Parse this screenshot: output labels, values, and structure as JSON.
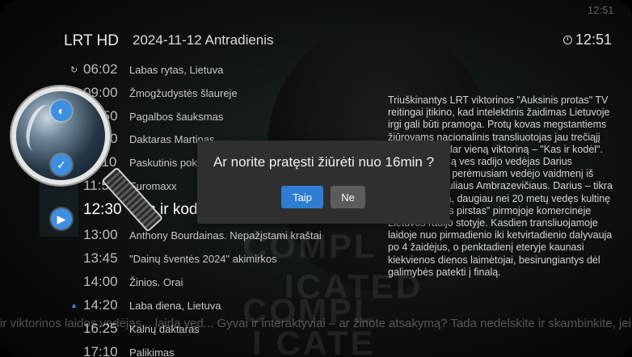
{
  "header": {
    "channel": "LRT HD",
    "date": "2024-11-12 Antradienis",
    "time": "12:51",
    "top_right": "12:51"
  },
  "schedule": [
    {
      "time": "06:02",
      "title": "Labas rytas, Lietuva",
      "icon": "replay-icon"
    },
    {
      "time": "09:00",
      "title": "Žmogžudystės šlaureje",
      "icon": ""
    },
    {
      "time": "09:50",
      "title": "Pagalbos šauksmas",
      "icon": ""
    },
    {
      "time": "10:20",
      "title": "Daktaras Martinas",
      "icon": ""
    },
    {
      "time": "11:10",
      "title": "Paskutinis pokalbis",
      "icon": ""
    },
    {
      "time": "11:55",
      "title": "Euromaxx",
      "icon": ""
    },
    {
      "time": "12:30",
      "title": "Kas ir kodėl",
      "icon": "",
      "current": true
    },
    {
      "time": "13:00",
      "title": "Anthony Bourdainas. Nepažįstami kraštai",
      "icon": ""
    },
    {
      "time": "13:45",
      "title": "\"Dainų šventės 2024\" akimirkos",
      "icon": ""
    },
    {
      "time": "14:00",
      "title": "Žinios. Orai",
      "icon": ""
    },
    {
      "time": "14:20",
      "title": "Laba diena, Lietuva",
      "icon": "reminder-icon"
    },
    {
      "time": "16:25",
      "title": "Kalnų daktaras",
      "icon": ""
    },
    {
      "time": "17:10",
      "title": "Palikimas",
      "icon": ""
    }
  ],
  "description": "Triuškinantys LRT viktorinos \"Auksinis protas\" TV reitingai įtikino, kad intelektinis žaidimas Lietuvoje irgi gali būti pramoga. Protų kovas megstantiems žiūrovams nacionalinis transliuotojas jau trečiąjį sezoną siūlo dar vieną viktoriną – \"Kas ir kodėl\". Šį sezoną laidą ves radijo vedėjas Darius Jurgelevičius, perėmusiam vedėjo vaidmenį iš humoristo Pauliaus Ambrazevičiaus. Darius – tikra radijo legenda, daugiau nei 20 metų vedęs kultinę laidą \"Mikliusis pirstas\" pirmojoje komercinėje Lietuvos radijo stotyje. Kasdien transliuojamoje laidoje nuo pirmadienio iki ketvirtadienio dalyvauja po 4 žaidėjus, o penktadienį eteryje kaunasi kiekvienos dienos laimėtojai, besirungiantys dėl galimybės patekti į finalą.",
  "ticker": "ir viktorinos laidos vedėjas... laidą ved... Gyvai ir interaktyviai – ar žinote atsakymą? Tada nedelskite ir skambinkite, jei esate pasiruošę žaisti...",
  "background_text": [
    "COMPL",
    "ICATED",
    "COMPL",
    "I CATE"
  ],
  "dialog": {
    "message": "Ar norite pratęsti žiūrėti nuo 16min ?",
    "yes_label": "Taip",
    "no_label": "Ne"
  },
  "overlay": {
    "lens_icon": "magnifier-icon",
    "buttons": [
      "contrast-icon",
      "check-icon",
      "play-icon"
    ]
  },
  "colors": {
    "accent": "#2f7dd1",
    "dialog_bg": "#2f2f2f",
    "button_secondary": "#5c5c5c"
  }
}
